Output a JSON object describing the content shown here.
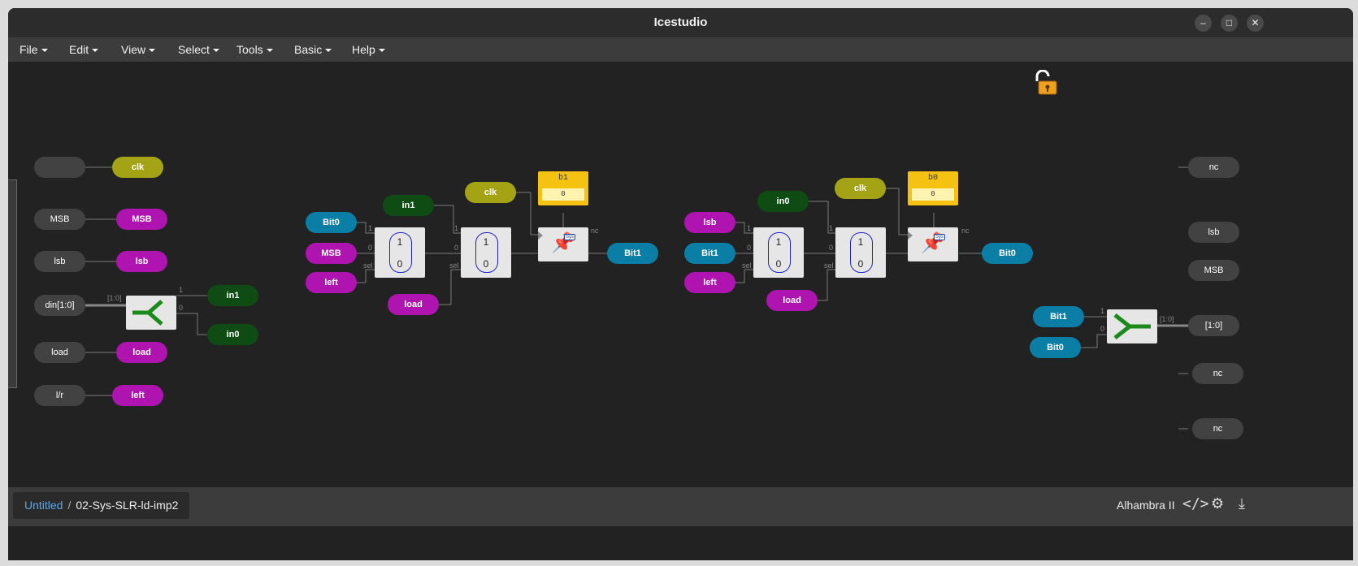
{
  "window": {
    "title": "Icestudio",
    "controls": {
      "minimize": "–",
      "maximize": "□",
      "close": "✕"
    }
  },
  "menu": [
    "File",
    "Edit",
    "View",
    "Select",
    "Tools",
    "Basic",
    "Help"
  ],
  "canvas": {
    "locked": false,
    "input_ports": [
      {
        "label": "",
        "net": "clk"
      },
      {
        "label": "MSB",
        "net": "MSB"
      },
      {
        "label": "lsb",
        "net": "lsb"
      },
      {
        "label": "din[1:0]",
        "net": ""
      },
      {
        "label": "load",
        "net": "load"
      },
      {
        "label": "l/r",
        "net": "left"
      }
    ],
    "splitter_left": {
      "bus": "[1:0]",
      "bit1": "1",
      "bit0": "0",
      "out1": "in1",
      "out0": "in0"
    },
    "stage1": {
      "in_a": "Bit0",
      "in_b": "MSB",
      "sel_a": "left",
      "mid_in": "in1",
      "load": "load",
      "clk": "clk",
      "const_name": "b1",
      "const_value": "0",
      "out": "Bit1",
      "nc": "nc",
      "mux_one": "1",
      "mux_zero": "0",
      "sel": "sel"
    },
    "stage2": {
      "in_a": "lsb",
      "in_b": "Bit1",
      "sel_a": "left",
      "mid_in": "in0",
      "load": "load",
      "clk": "clk",
      "const_name": "b0",
      "const_value": "0",
      "out": "Bit0",
      "nc": "nc",
      "mux_one": "1",
      "mux_zero": "0",
      "sel": "sel"
    },
    "joiner_right": {
      "in1": "Bit1",
      "in0": "Bit0",
      "bus": "[1:0]",
      "bit1": "1",
      "bit0": "0"
    },
    "output_ports": [
      "nc",
      "lsb",
      "MSB",
      "[1:0]",
      "nc",
      "nc"
    ]
  },
  "status": {
    "breadcrumb_root": "Untitled",
    "breadcrumb_sep": "/",
    "breadcrumb_current": "02-Sys-SLR-ld-imp2",
    "board": "Alhambra II",
    "icons": [
      "code-icon",
      "gear-icon",
      "download-icon"
    ]
  }
}
